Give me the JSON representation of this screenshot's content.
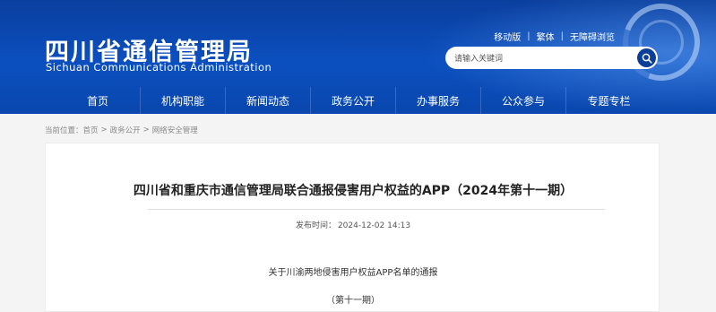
{
  "header": {
    "title": "四川省通信管理局",
    "subtitle": "Sichuan Communications Administration",
    "top_links": [
      "移动版",
      "繁体",
      "无障碍浏览"
    ],
    "search_placeholder": "请输入关键词",
    "search_icon": "search-icon"
  },
  "nav": {
    "items": [
      "首页",
      "机构职能",
      "新闻动态",
      "政务公开",
      "办事服务",
      "公众参与",
      "专题专栏"
    ]
  },
  "breadcrumb": {
    "prefix": "当前位置：",
    "items": [
      "首页",
      "政务公开",
      "网络安全管理"
    ],
    "separator": ">"
  },
  "article": {
    "title": "四川省和重庆市通信管理局联合通报侵害用户权益的APP（2024年第十一期）",
    "publish_label": "发布时间：",
    "publish_time": "2024-12-02 14:13",
    "para1": "关于川渝两地侵害用户权益APP名单的通报",
    "para2": "（第十一期）"
  },
  "colors": {
    "header_blue": "#0b4fbf",
    "search_button": "#0b3e98"
  }
}
